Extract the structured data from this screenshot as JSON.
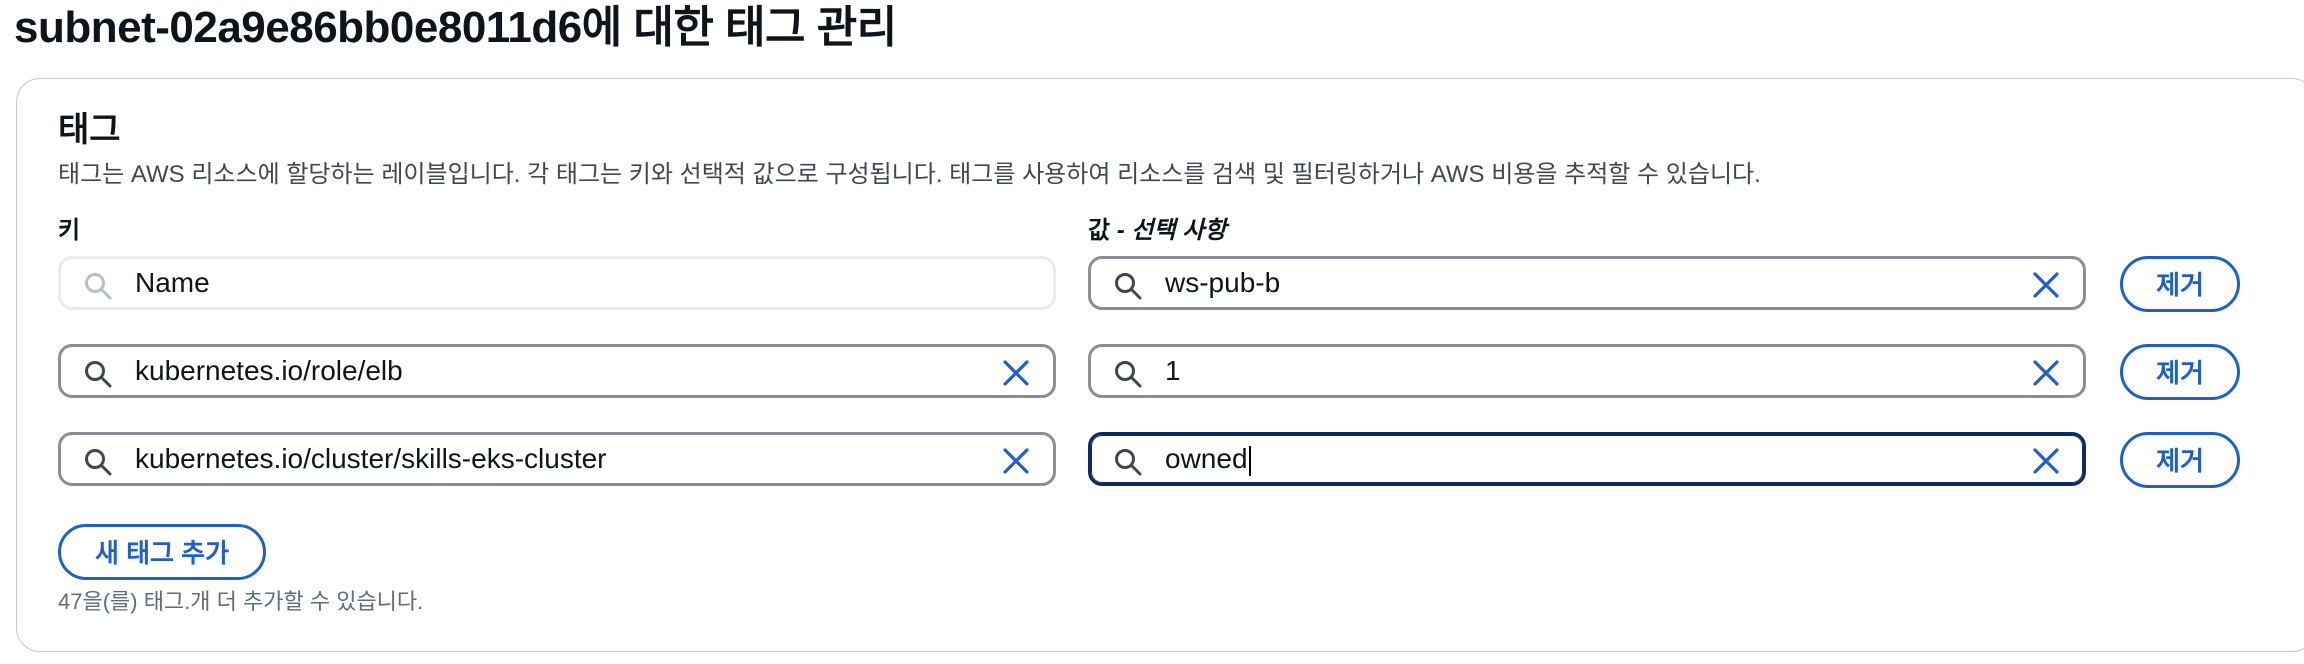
{
  "page": {
    "title": "subnet-02a9e86bb0e8011d6에 대한 태그 관리"
  },
  "tags_section": {
    "title": "태그",
    "description": "태그는 AWS 리소스에 할당하는 레이블입니다. 각 태그는 키와 선택적 값으로 구성됩니다. 태그를 사용하여 리소스를 검색 및 필터링하거나 AWS 비용을 추적할 수 있습니다.",
    "key_label": "키",
    "value_label_main": "값",
    "value_label_optional": " - 선택 사항",
    "rows": [
      {
        "key": "Name",
        "value": "ws-pub-b",
        "remove_label": "제거"
      },
      {
        "key": "kubernetes.io/role/elb",
        "value": "1",
        "remove_label": "제거"
      },
      {
        "key": "kubernetes.io/cluster/skills-eks-cluster",
        "value": "owned",
        "remove_label": "제거"
      }
    ],
    "add_button_label": "새 태그 추가",
    "limit_note": "47을(를) 태그.개 더 추가할 수 있습니다."
  },
  "colors": {
    "accent": "#1f5fc6",
    "focus_border": "#0f2a63",
    "input_border": "#8c8c94",
    "readonly_border": "#e9ebed"
  },
  "icons": {
    "search": "search-icon",
    "clear": "close-icon"
  }
}
